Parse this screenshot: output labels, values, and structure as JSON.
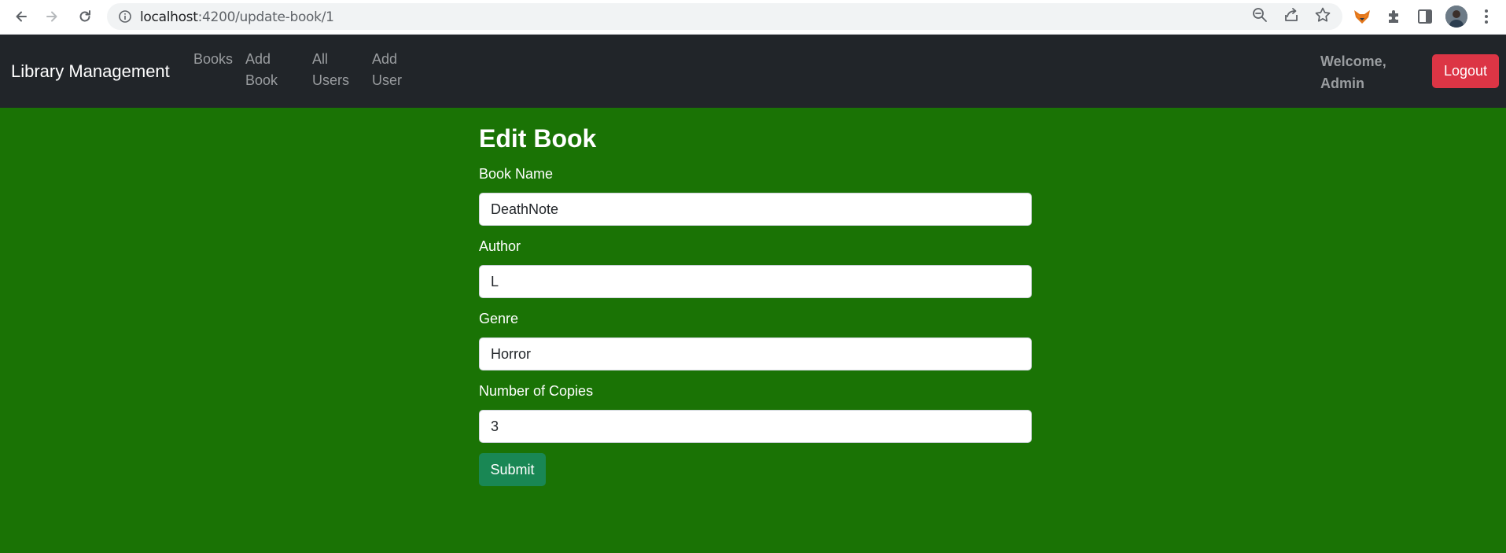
{
  "browser": {
    "url_host": "localhost",
    "url_path": ":4200/update-book/1"
  },
  "navbar": {
    "brand": "Library Management",
    "links": [
      {
        "label": "Books"
      },
      {
        "label": "Add\nBook"
      },
      {
        "label": "All\nUsers"
      },
      {
        "label": "Add\nUser"
      }
    ],
    "welcome": "Welcome, Admin",
    "logout_label": "Logout"
  },
  "form": {
    "title": "Edit Book",
    "fields": [
      {
        "label": "Book Name",
        "value": "DeathNote"
      },
      {
        "label": "Author",
        "value": "L"
      },
      {
        "label": "Genre",
        "value": "Horror"
      },
      {
        "label": "Number of Copies",
        "value": "3"
      }
    ],
    "submit_label": "Submit"
  },
  "colors": {
    "page_background": "#1a7305",
    "navbar_background": "#212529",
    "logout_button": "#dc3545",
    "submit_button": "#198754"
  }
}
